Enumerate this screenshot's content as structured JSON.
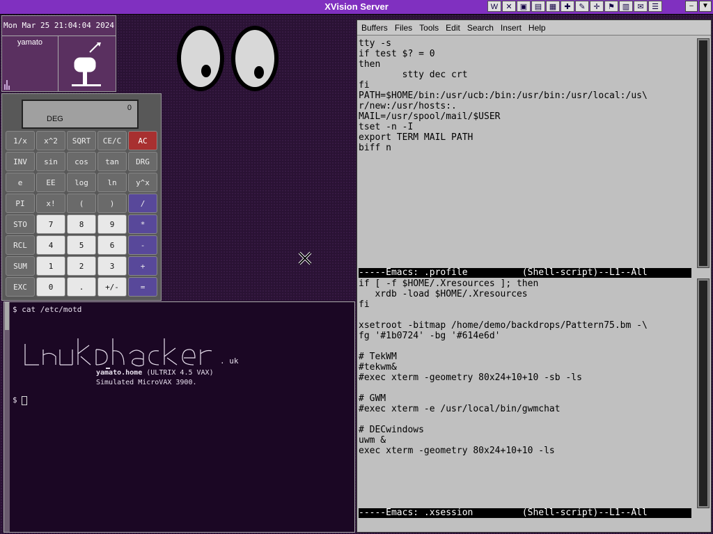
{
  "titlebar": {
    "title": "XVision Server",
    "tool_icons": [
      "W",
      "✕",
      "▣",
      "▤",
      "▦",
      "✚",
      "✎",
      "✛",
      "⚑",
      "▥",
      "✉",
      "☰"
    ]
  },
  "clock": {
    "datetime": "Mon Mar 25 21:04:04 2024",
    "user": "yamato"
  },
  "calculator": {
    "mode": "DEG",
    "display": "0",
    "keys": [
      {
        "label": "1/x",
        "kind": "fn"
      },
      {
        "label": "x^2",
        "kind": "fn"
      },
      {
        "label": "SQRT",
        "kind": "fn"
      },
      {
        "label": "CE/C",
        "kind": "fn"
      },
      {
        "label": "AC",
        "kind": "ac"
      },
      {
        "label": "INV",
        "kind": "fn"
      },
      {
        "label": "sin",
        "kind": "fn"
      },
      {
        "label": "cos",
        "kind": "fn"
      },
      {
        "label": "tan",
        "kind": "fn"
      },
      {
        "label": "DRG",
        "kind": "fn"
      },
      {
        "label": "e",
        "kind": "fn"
      },
      {
        "label": "EE",
        "kind": "fn"
      },
      {
        "label": "log",
        "kind": "fn"
      },
      {
        "label": "ln",
        "kind": "fn"
      },
      {
        "label": "y^x",
        "kind": "fn"
      },
      {
        "label": "PI",
        "kind": "fn"
      },
      {
        "label": "x!",
        "kind": "fn"
      },
      {
        "label": "(",
        "kind": "fn"
      },
      {
        "label": ")",
        "kind": "fn"
      },
      {
        "label": "/",
        "kind": "op"
      },
      {
        "label": "STO",
        "kind": "fn"
      },
      {
        "label": "7",
        "kind": "num"
      },
      {
        "label": "8",
        "kind": "num"
      },
      {
        "label": "9",
        "kind": "num"
      },
      {
        "label": "*",
        "kind": "op"
      },
      {
        "label": "RCL",
        "kind": "fn"
      },
      {
        "label": "4",
        "kind": "num"
      },
      {
        "label": "5",
        "kind": "num"
      },
      {
        "label": "6",
        "kind": "num"
      },
      {
        "label": "-",
        "kind": "op"
      },
      {
        "label": "SUM",
        "kind": "fn"
      },
      {
        "label": "1",
        "kind": "num"
      },
      {
        "label": "2",
        "kind": "num"
      },
      {
        "label": "3",
        "kind": "num"
      },
      {
        "label": "+",
        "kind": "op"
      },
      {
        "label": "EXC",
        "kind": "fn"
      },
      {
        "label": "0",
        "kind": "num"
      },
      {
        "label": ".",
        "kind": "num"
      },
      {
        "label": "+/-",
        "kind": "num"
      },
      {
        "label": "=",
        "kind": "op"
      }
    ]
  },
  "xterm": {
    "cmd_line": "$ cat /etc/motd",
    "motd_suffix": ". uk",
    "motd_host": "yamato.home",
    "motd_os": " (ULTRIX 4.5 VAX)",
    "motd_line2": "Simulated MicroVAX 3900.",
    "prompt": "$ "
  },
  "emacs": {
    "menu": [
      "Buffers",
      "Files",
      "Tools",
      "Edit",
      "Search",
      "Insert",
      "Help"
    ],
    "buffer1": "tty -s\nif test $? = 0\nthen\n        stty dec crt\nfi\nPATH=$HOME/bin:/usr/ucb:/bin:/usr/bin:/usr/local:/us\\\nr/new:/usr/hosts:.\nMAIL=/usr/spool/mail/$USER\ntset -n -I\nexport TERM MAIL PATH\nbiff n",
    "modeline1": "-----Emacs: .profile          (Shell-script)--L1--All",
    "buffer2": "if [ -f $HOME/.Xresources ]; then\n   xrdb -load $HOME/.Xresources\nfi\n\nxsetroot -bitmap /home/demo/backdrops/Pattern75.bm -\\\nfg '#1b0724' -bg '#614e6d'\n\n# TekWM\n#tekwm&\n#exec xterm -geometry 80x24+10+10 -sb -ls\n\n# GWM\n#exec xterm -e /usr/local/bin/gwmchat\n\n# DECwindows\nuwm &\nexec xterm -geometry 80x24+10+10 -ls",
    "modeline2": "-----Emacs: .xsession         (Shell-script)--L1--All"
  }
}
